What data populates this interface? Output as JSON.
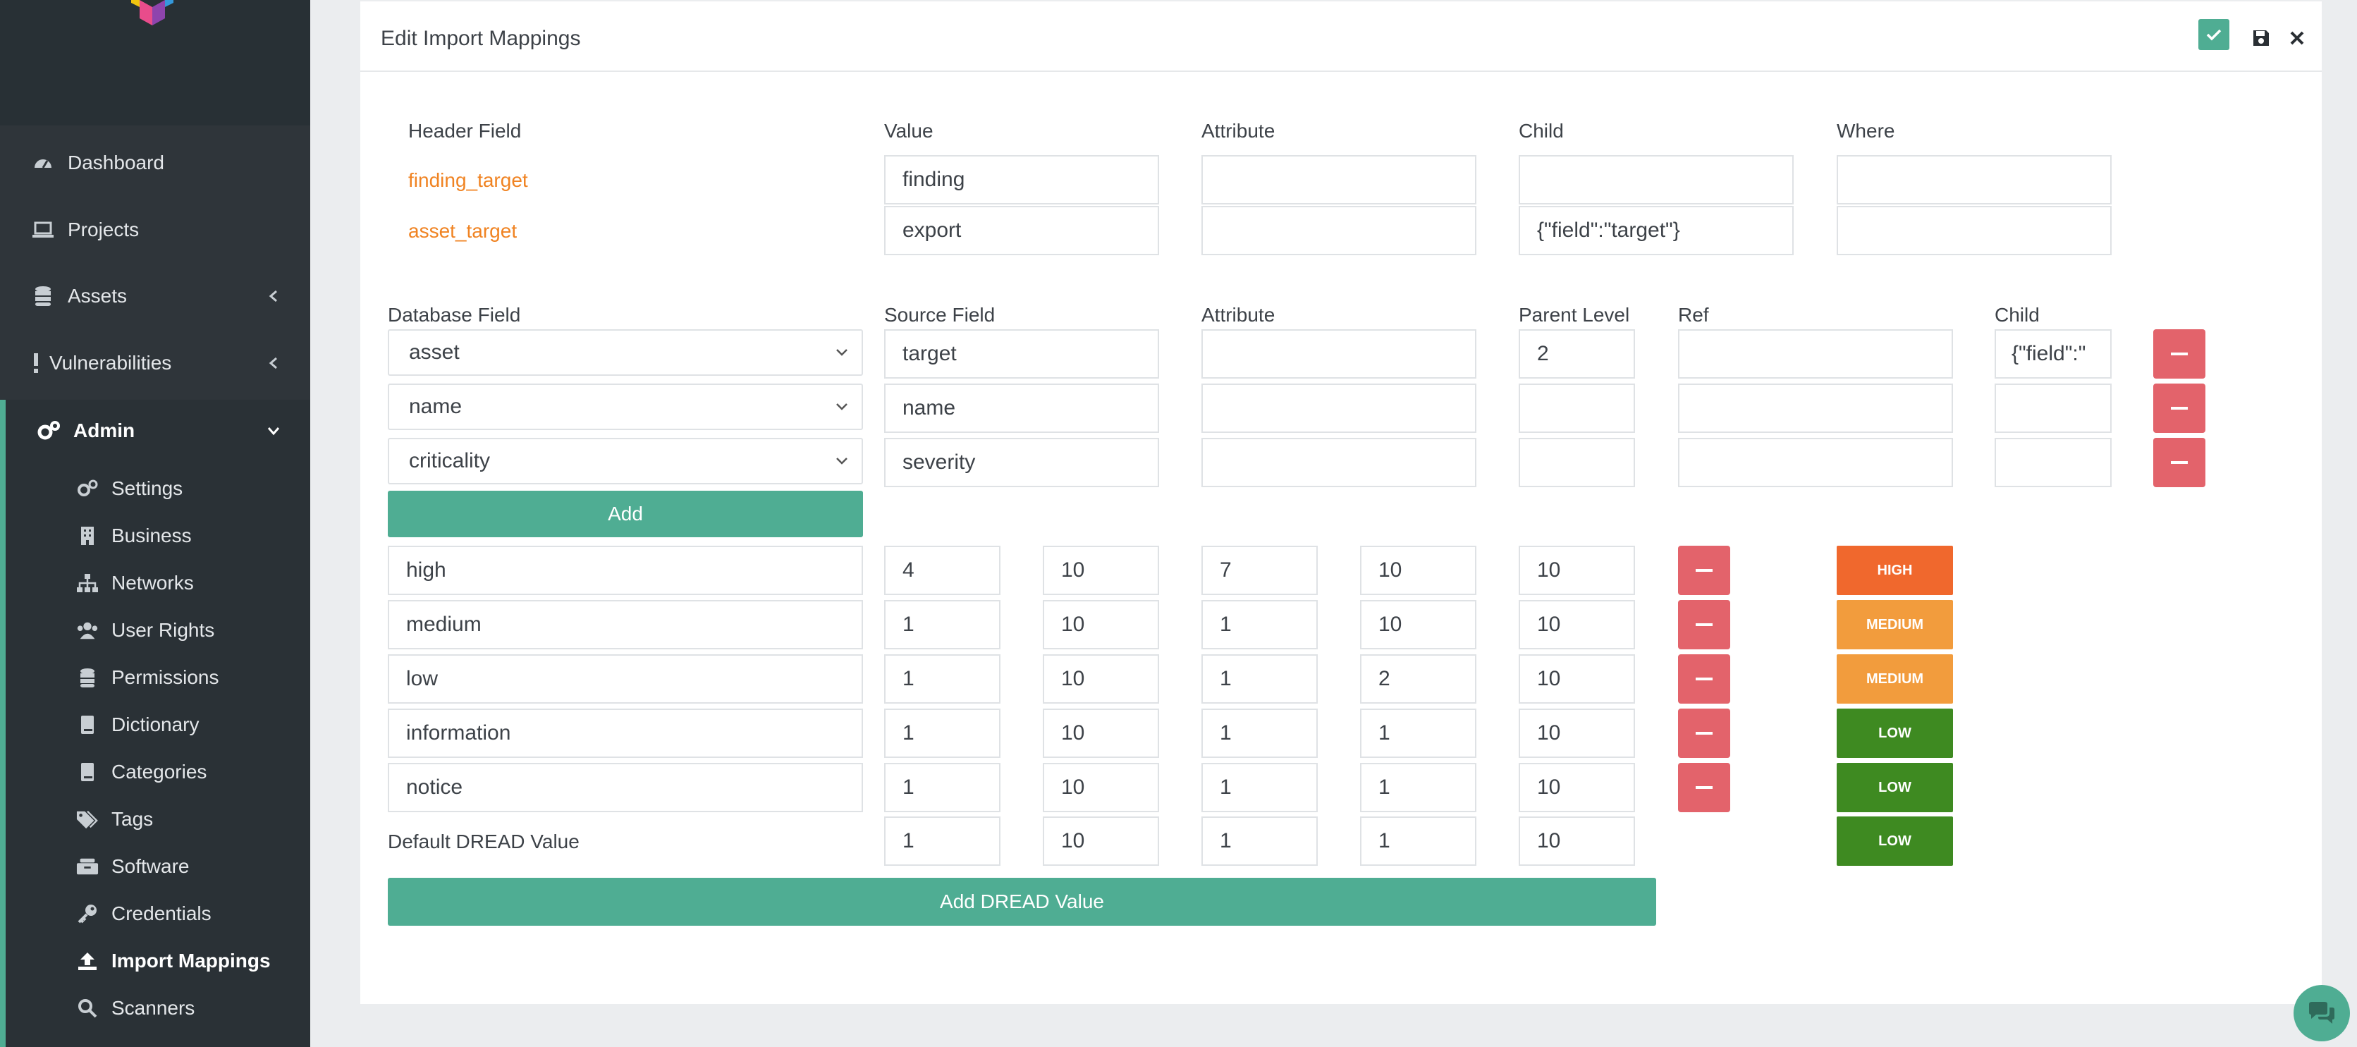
{
  "sidebar": {
    "items": [
      {
        "label": "Dashboard",
        "icon": "tachometer-icon"
      },
      {
        "label": "Projects",
        "icon": "laptop-icon"
      },
      {
        "label": "Assets",
        "icon": "database-icon"
      },
      {
        "label": "Vulnerabilities",
        "icon": "exclamation-icon"
      },
      {
        "label": "Admin",
        "icon": "cogs-icon"
      }
    ],
    "admin_items": [
      {
        "label": "Settings",
        "icon": "cogs-icon"
      },
      {
        "label": "Business",
        "icon": "building-icon"
      },
      {
        "label": "Networks",
        "icon": "sitemap-icon"
      },
      {
        "label": "User Rights",
        "icon": "users-icon"
      },
      {
        "label": "Permissions",
        "icon": "database-icon"
      },
      {
        "label": "Dictionary",
        "icon": "book-icon"
      },
      {
        "label": "Categories",
        "icon": "book-icon"
      },
      {
        "label": "Tags",
        "icon": "tags-icon"
      },
      {
        "label": "Software",
        "icon": "boxes-icon"
      },
      {
        "label": "Credentials",
        "icon": "key-icon"
      },
      {
        "label": "Import Mappings",
        "icon": "upload-icon",
        "active": true
      },
      {
        "label": "Scanners",
        "icon": "search-icon"
      }
    ]
  },
  "panel": {
    "title": "Edit Import Mappings"
  },
  "header_section": {
    "columns": [
      "Header Field",
      "Value",
      "Attribute",
      "Child",
      "Where"
    ],
    "rows": [
      {
        "field": "finding_target",
        "value": "finding",
        "attribute": "",
        "child": "",
        "where": ""
      },
      {
        "field": "asset_target",
        "value": "export",
        "attribute": "",
        "child": "{\"field\":\"target\"}",
        "where": ""
      }
    ]
  },
  "db_section": {
    "columns": [
      "Database Field",
      "Source Field",
      "Attribute",
      "Parent Level",
      "Ref",
      "Child"
    ],
    "rows": [
      {
        "db_field": "asset",
        "source": "target",
        "attribute": "",
        "parent_level": "2",
        "ref": "",
        "child": "{\"field\":\""
      },
      {
        "db_field": "name",
        "source": "name",
        "attribute": "",
        "parent_level": "",
        "ref": "",
        "child": ""
      },
      {
        "db_field": "criticality",
        "source": "severity",
        "attribute": "",
        "parent_level": "",
        "ref": "",
        "child": ""
      }
    ],
    "add_label": "Add"
  },
  "dread_section": {
    "rows": [
      {
        "name": "high",
        "values": [
          "4",
          "10",
          "7",
          "10",
          "10"
        ],
        "badge": "HIGH",
        "badge_color": "#f0682d"
      },
      {
        "name": "medium",
        "values": [
          "1",
          "10",
          "1",
          "10",
          "10"
        ],
        "badge": "MEDIUM",
        "badge_color": "#f29c3d"
      },
      {
        "name": "low",
        "values": [
          "1",
          "10",
          "1",
          "2",
          "10"
        ],
        "badge": "MEDIUM",
        "badge_color": "#f29c3d"
      },
      {
        "name": "information",
        "values": [
          "1",
          "10",
          "1",
          "1",
          "10"
        ],
        "badge": "LOW",
        "badge_color": "#3e8a21"
      },
      {
        "name": "notice",
        "values": [
          "1",
          "10",
          "1",
          "1",
          "10"
        ],
        "badge": "LOW",
        "badge_color": "#3e8a21"
      }
    ],
    "default_label": "Default DREAD Value",
    "default_values": [
      "1",
      "10",
      "1",
      "1",
      "10"
    ],
    "default_badge": "LOW",
    "default_badge_color": "#3e8a21",
    "add_label": "Add DREAD Value"
  },
  "colors": {
    "accent": "#4fad93",
    "danger": "#e3636b",
    "link_orange": "#f08322",
    "sidebar_bg": "#2f353a"
  }
}
